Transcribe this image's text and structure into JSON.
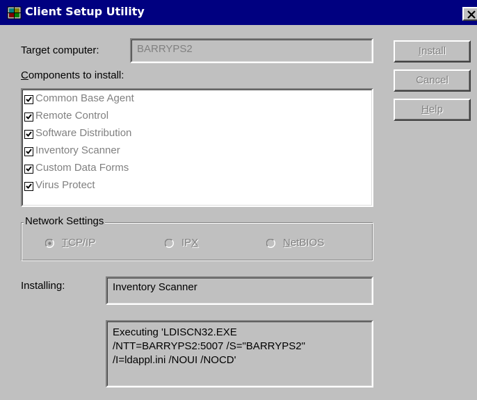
{
  "window": {
    "title": "Client Setup Utility"
  },
  "target": {
    "label": "Target computer:",
    "value": "BARRYPS2"
  },
  "components": {
    "label_underline": "C",
    "label_rest": "omponents to install:",
    "items": [
      {
        "label": "Common Base Agent",
        "checked": true
      },
      {
        "label": "Remote Control",
        "checked": true
      },
      {
        "label": "Software Distribution",
        "checked": true
      },
      {
        "label": "Inventory Scanner",
        "checked": true
      },
      {
        "label": "Custom Data Forms",
        "checked": true
      },
      {
        "label": "Virus Protect",
        "checked": true
      }
    ]
  },
  "network": {
    "legend": "Network Settings",
    "options": [
      {
        "underline": "T",
        "rest": "CP/IP",
        "selected": true
      },
      {
        "pre": "IP",
        "underline": "X",
        "selected": false
      },
      {
        "underline": "N",
        "rest": "etBIOS",
        "selected": false
      }
    ]
  },
  "buttons": {
    "install": {
      "underline": "I",
      "rest": "nstall"
    },
    "cancel": {
      "label": "Cancel"
    },
    "help": {
      "underline": "H",
      "rest": "elp"
    }
  },
  "status": {
    "installing_label": "Installing:",
    "current_component": "Inventory Scanner",
    "log": "Executing 'LDISCN32.EXE\n/NTT=BARRYPS2:5007 /S=\"BARRYPS2\"\n/I=ldappl.ini /NOUI /NOCD'"
  },
  "colors": {
    "title_bar": "#000080",
    "face": "#c0c0c0",
    "disabled_text": "#808080"
  },
  "icons": {
    "title": "setup-app-icon",
    "close": "close-icon",
    "check": "checkmark-icon"
  }
}
